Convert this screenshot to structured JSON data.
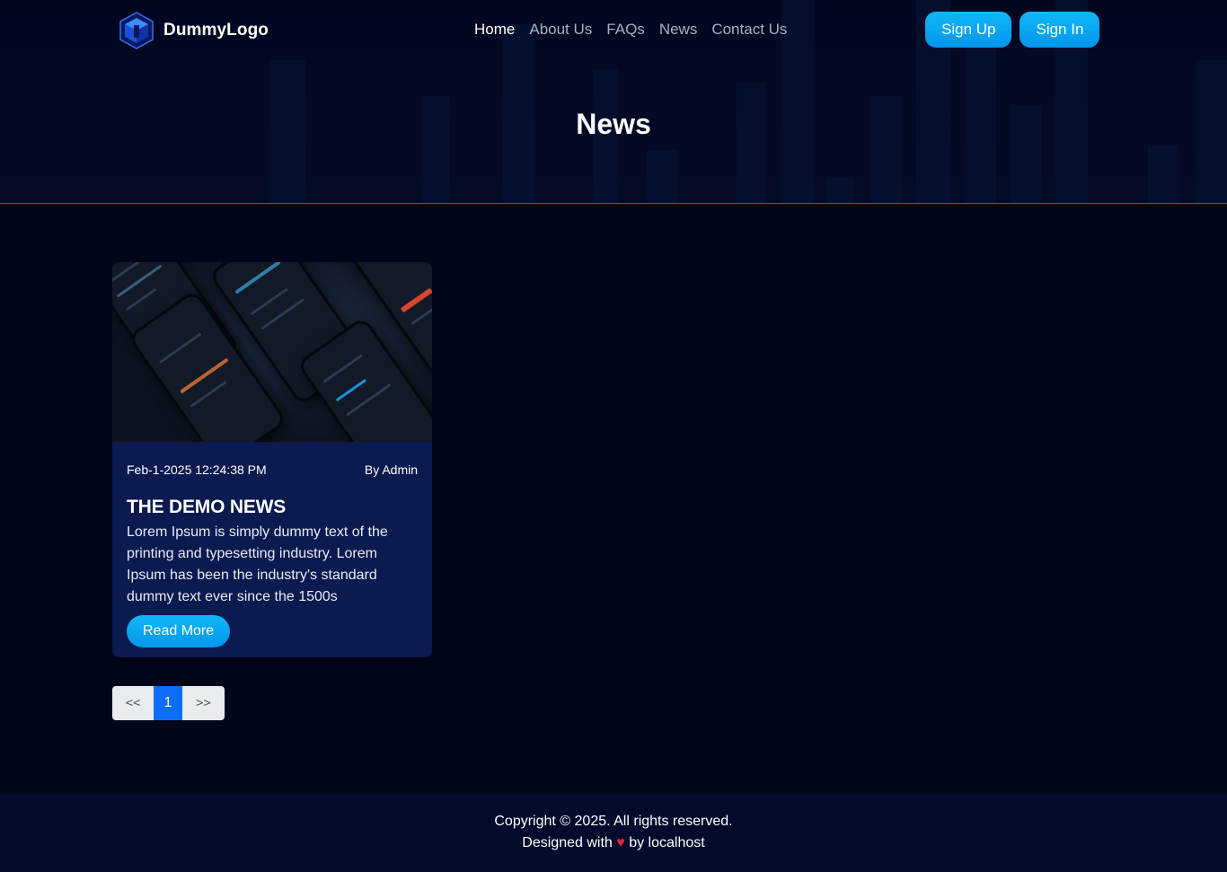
{
  "brand": {
    "name": "DummyLogo",
    "logo_icon": "cube-logo-icon",
    "accent": "#0ea5f5"
  },
  "nav": {
    "items": [
      {
        "label": "Home",
        "active": true
      },
      {
        "label": "About Us",
        "active": false
      },
      {
        "label": "FAQs",
        "active": false
      },
      {
        "label": "News",
        "active": false
      },
      {
        "label": "Contact Us",
        "active": false
      }
    ]
  },
  "auth": {
    "sign_up": "Sign Up",
    "sign_in": "Sign In"
  },
  "page": {
    "title": "News"
  },
  "news": [
    {
      "date": "Feb-1-2025 12:24:38 PM",
      "author": "By Admin",
      "title": "THE DEMO NEWS",
      "excerpt": "Lorem Ipsum is simply dummy text of the printing and typesetting industry. Lorem Ipsum has been the industry's standard dummy text ever since the 1500s",
      "cta": "Read More",
      "image": "phone-app-mockups-image"
    }
  ],
  "pagination": {
    "prev": "<<",
    "current": "1",
    "next": ">>"
  },
  "footer": {
    "copyright": "Copyright © 2025. All rights reserved.",
    "designed_prefix": "Designed with",
    "heart": "♥",
    "designed_suffix": "by localhost"
  },
  "colors": {
    "background": "#02061a",
    "card": "#0b1a4f",
    "button": "#0296ec",
    "pagination_active": "#0d6efd",
    "heart": "#e0273a"
  }
}
